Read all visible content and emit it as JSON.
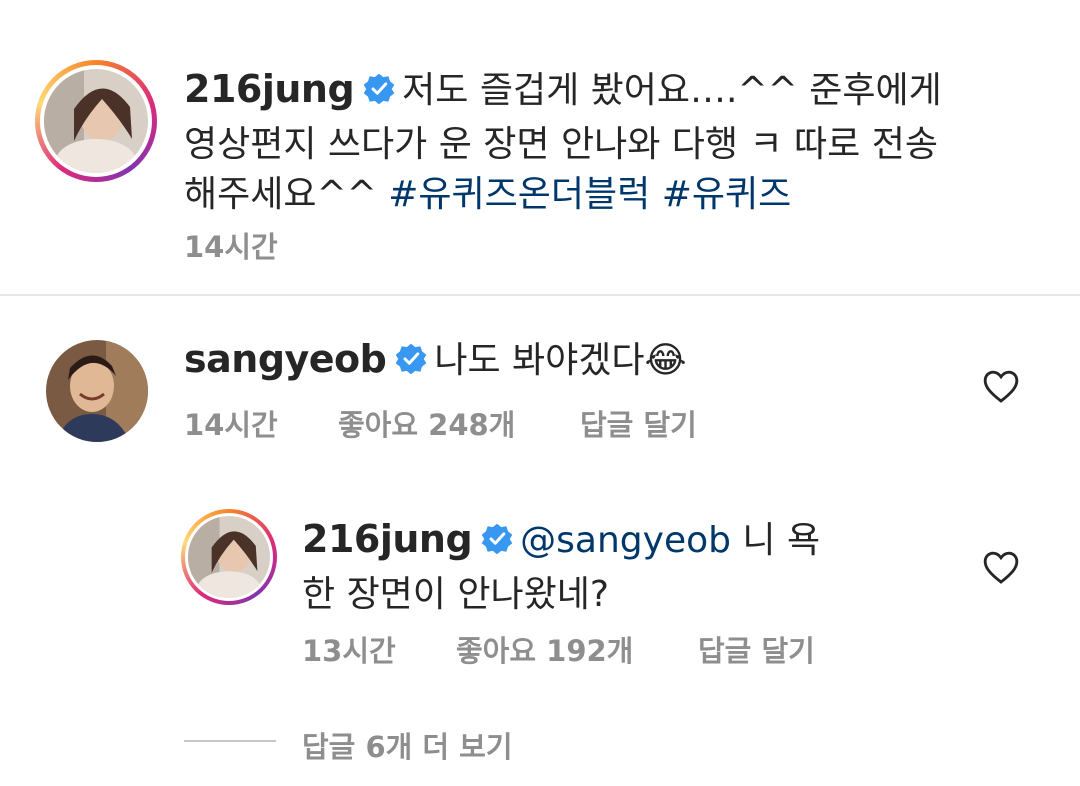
{
  "comments": [
    {
      "username": "216jung",
      "verified": true,
      "text_main": "저도 즐겁게 봤어요….^^ 준후에게 영상편지 쓰다가 운 장면 안나와 다행 ㅋ 따로 전송해주세요^^ ",
      "hashtags": [
        "#유퀴즈온더블럭",
        "#유퀴즈"
      ],
      "time": "14시간"
    },
    {
      "username": "sangyeob",
      "verified": true,
      "text": "나도 봐야겠다😂",
      "time": "14시간",
      "likes": "좋아요 248개",
      "reply_label": "답글 달기",
      "reply": {
        "username": "216jung",
        "verified": true,
        "mention": "@sangyeob",
        "text": " 니 욕 한 장면이 안나왔네?",
        "time": "13시간",
        "likes": "좋아요 192개",
        "reply_label": "답글 달기"
      },
      "more_replies": "답글 6개 더 보기"
    }
  ],
  "icons": {
    "verified": "verified-badge-icon",
    "heart": "heart-outline-icon"
  },
  "colors": {
    "verified": "#3897f0",
    "hashtag": "#00376b",
    "meta": "#8e8e8e"
  }
}
